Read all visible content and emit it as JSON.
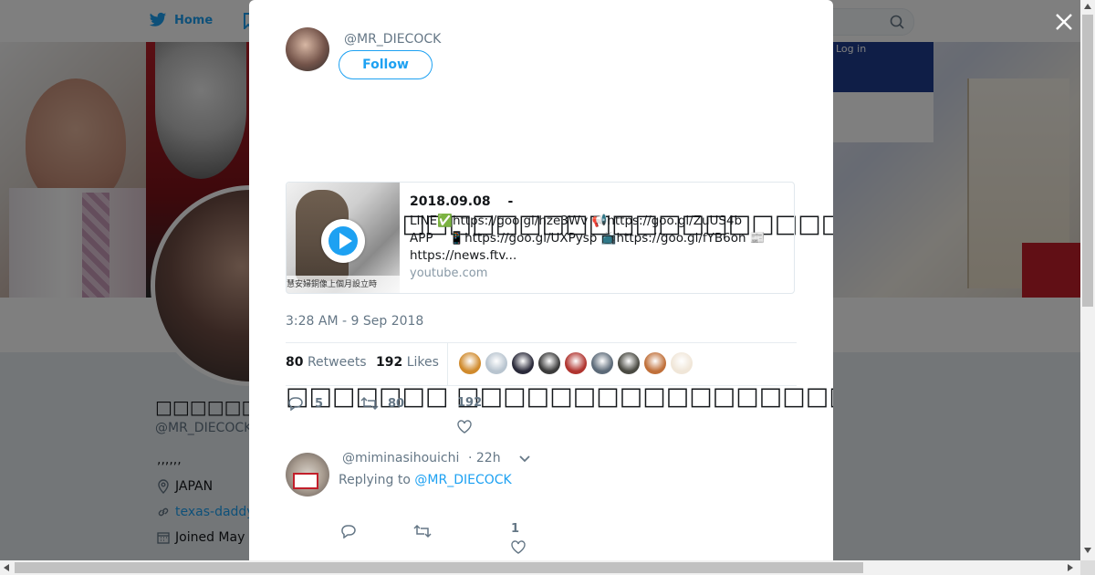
{
  "nav": {
    "home_label": "Home",
    "login_label": "Log in"
  },
  "profile": {
    "name": "□□□□□□□□□□□",
    "handle": "@MR_DIECOCK",
    "bio": ",,,,,,",
    "location": "JAPAN",
    "url": "texas-daddy",
    "joined": "Joined May"
  },
  "tweet": {
    "author_handle": "@MR_DIECOCK",
    "follow_label": "Follow",
    "text_line1": "□□□□□□□□□□□□□□□□□□□□□□□□□□□□□□□□□□□□□□□□□□□",
    "text_line2": "□□□□□□□ □□□□□□□□□□□□□□□□□□□□ - □□□□□□□",
    "time": "3:28 AM - 9 Sep 2018",
    "retweets_count": "80",
    "retweets_label": "Retweets",
    "likes_count": "192",
    "likes_label": "Likes",
    "reply_count": "5",
    "retweet_count": "80",
    "like_count": "192"
  },
  "card": {
    "title": "2018.09.08　 -",
    "desc_line1": "LINE✅https://goo.gl/hze3Wv 📢https://goo.gl/ZuUS4b",
    "desc_line2": "APP　 📱https://goo.gl/UXPysp 📺https://goo.gl/fYB6on 📰",
    "desc_line3": "https://news.ftv...",
    "domain": "youtube.com",
    "thumb_caption": "慧安婦銅像上個月設立時"
  },
  "likers": [
    {
      "color": "#d08a2c"
    },
    {
      "color": "#b8c4cf"
    },
    {
      "color": "#2a2a3a"
    },
    {
      "color": "#3b3b3b"
    },
    {
      "color": "#b0342f"
    },
    {
      "color": "#5c6a78"
    },
    {
      "color": "#4a4a42"
    },
    {
      "color": "#c0703a"
    },
    {
      "color": "#f0e6d8"
    }
  ],
  "reply": {
    "user": "@miminasihouichi",
    "time": "· 22h",
    "replying_label": "Replying to",
    "replying_handle": "@MR_DIECOCK",
    "like_count": "1"
  },
  "colors": {
    "accent": "#1da1f2",
    "muted": "#657786"
  }
}
